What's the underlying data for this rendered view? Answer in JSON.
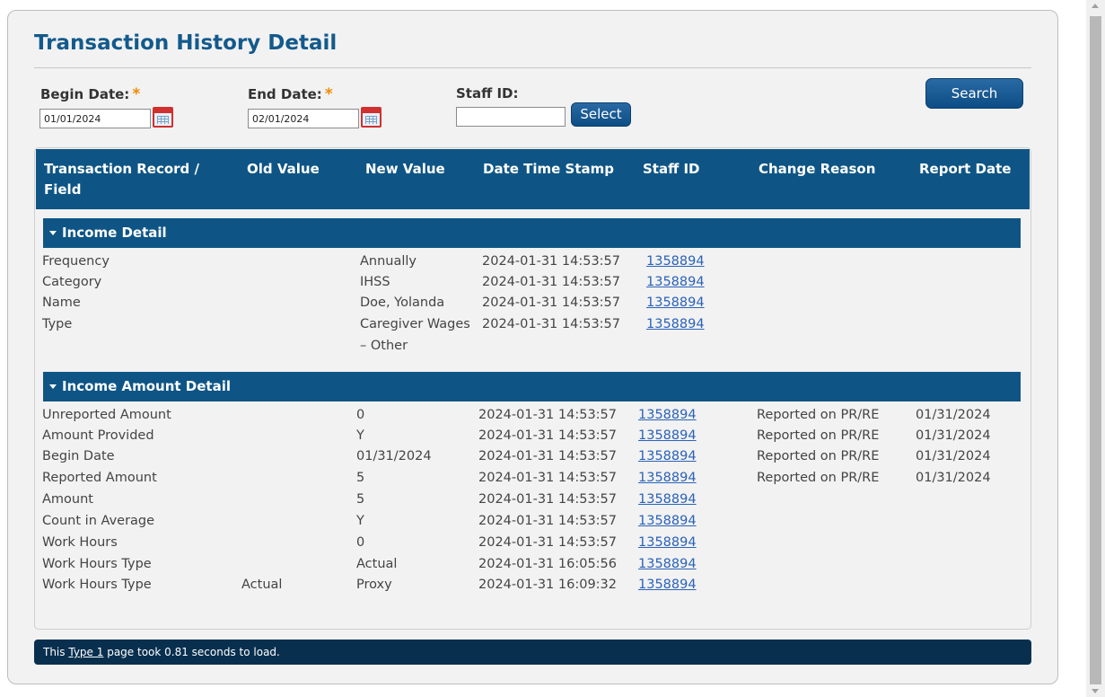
{
  "page": {
    "title": "Transaction History Detail"
  },
  "filters": {
    "begin_label": "Begin Date:",
    "begin_value": "01/01/2024",
    "end_label": "End Date:",
    "end_value": "02/01/2024",
    "staff_label": "Staff ID:",
    "staff_value": "",
    "required_mark": "*",
    "select_label": "Select",
    "search_label": "Search"
  },
  "table": {
    "headers": [
      "Transaction Record /",
      "Field",
      "Old Value",
      "New Value",
      "Date Time Stamp",
      "Staff ID",
      "Change Reason",
      "Report Date"
    ],
    "sections": [
      {
        "title": "Income Detail",
        "rows": [
          {
            "field": "Frequency",
            "old": "",
            "new": "Annually",
            "new2": "",
            "stamp": "2024-01-31 14:53:57",
            "staff": "1358894",
            "reason": "",
            "report": ""
          },
          {
            "field": "Category",
            "old": "",
            "new": "IHSS",
            "new2": "",
            "stamp": "2024-01-31 14:53:57",
            "staff": "1358894",
            "reason": "",
            "report": ""
          },
          {
            "field": "Name",
            "old": "",
            "new": "Doe, Yolanda",
            "new2": "",
            "stamp": "2024-01-31 14:53:57",
            "staff": "1358894",
            "reason": "",
            "report": ""
          },
          {
            "field": "Type",
            "old": "",
            "new": "Caregiver Wages",
            "new2": "– Other",
            "stamp": "2024-01-31 14:53:57",
            "staff": "1358894",
            "reason": "",
            "report": ""
          }
        ]
      },
      {
        "title": "Income Amount Detail",
        "rows": [
          {
            "field": "Unreported Amount",
            "old": "",
            "new": "0",
            "stamp": "2024-01-31 14:53:57",
            "staff": "1358894",
            "reason": "Reported on PR/RE",
            "report": "01/31/2024"
          },
          {
            "field": "Amount Provided",
            "old": "",
            "new": "Y",
            "stamp": "2024-01-31 14:53:57",
            "staff": "1358894",
            "reason": "Reported on PR/RE",
            "report": "01/31/2024"
          },
          {
            "field": "Begin Date",
            "old": "",
            "new": "01/31/2024",
            "stamp": "2024-01-31 14:53:57",
            "staff": "1358894",
            "reason": "Reported on PR/RE",
            "report": "01/31/2024"
          },
          {
            "field": "Reported Amount",
            "old": "",
            "new": "5",
            "stamp": "2024-01-31 14:53:57",
            "staff": "1358894",
            "reason": "Reported on PR/RE",
            "report": "01/31/2024"
          },
          {
            "field": "Amount",
            "old": "",
            "new": "5",
            "stamp": "2024-01-31 14:53:57",
            "staff": "1358894",
            "reason": "",
            "report": ""
          },
          {
            "field": "Count in Average",
            "old": "",
            "new": "Y",
            "stamp": "2024-01-31 14:53:57",
            "staff": "1358894",
            "reason": "",
            "report": ""
          },
          {
            "field": "Work Hours",
            "old": "",
            "new": "0",
            "stamp": "2024-01-31 14:53:57",
            "staff": "1358894",
            "reason": "",
            "report": ""
          },
          {
            "field": "Work Hours Type",
            "old": "",
            "new": "Actual",
            "stamp": "2024-01-31 16:05:56",
            "staff": "1358894",
            "reason": "",
            "report": ""
          },
          {
            "field": "Work Hours Type",
            "old": "Actual",
            "new": "Proxy",
            "stamp": "2024-01-31 16:09:32",
            "staff": "1358894",
            "reason": "",
            "report": ""
          }
        ]
      }
    ]
  },
  "footer": {
    "prefix": "This",
    "link": "Type 1",
    "suffix": "page took 0.81 seconds to load."
  }
}
